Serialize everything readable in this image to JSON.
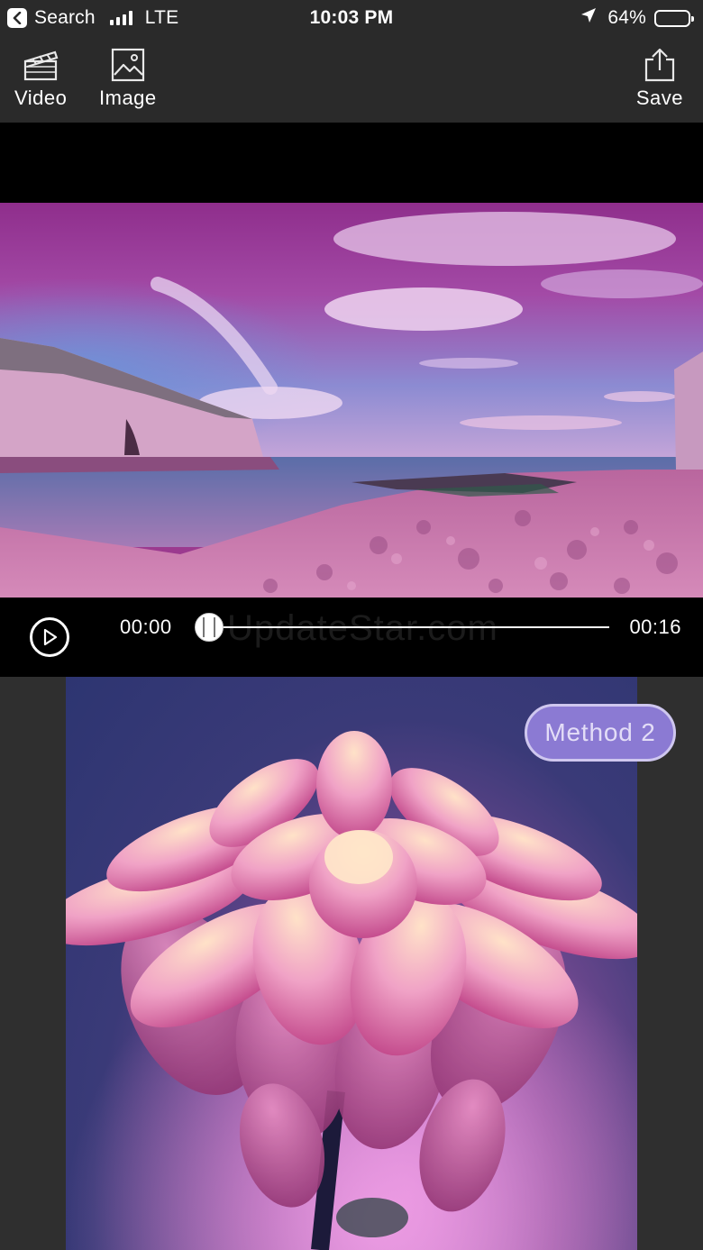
{
  "status_bar": {
    "back_label": "Search",
    "network": "LTE",
    "time": "10:03 PM",
    "battery": "64%",
    "battery_level": 0.64
  },
  "toolbar": {
    "video_label": "Video",
    "image_label": "Image",
    "save_label": "Save"
  },
  "player": {
    "current_time": "00:00",
    "total_time": "00:16",
    "progress": 0,
    "watermark": "UpdateStar.com"
  },
  "image_panel": {
    "method_label": "Method 2"
  },
  "colors": {
    "bar_bg": "#2a2a2a",
    "player_bg": "#000000",
    "badge_bg": "#8b7ad3",
    "badge_border": "#cfc7ef"
  }
}
